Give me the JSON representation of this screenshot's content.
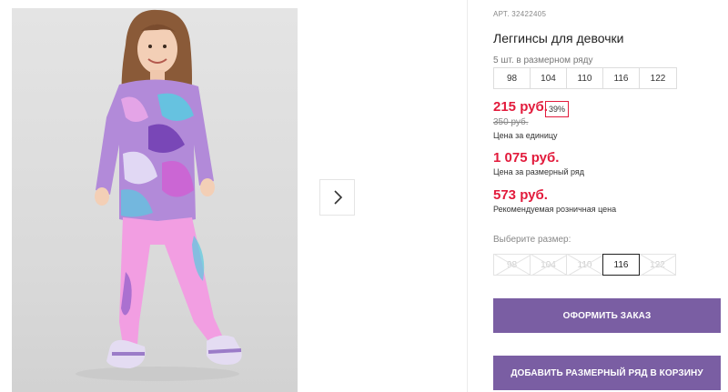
{
  "product": {
    "article": "АРТ. 32422405",
    "title": "Леггинсы для девочки",
    "size_row_caption": "5 шт. в размерном ряду",
    "size_row": [
      "98",
      "104",
      "110",
      "116",
      "122"
    ]
  },
  "pricing": {
    "unit_price": "215 руб.",
    "discount": "39%",
    "old_price": "350 руб.",
    "unit_caption": "Цена за единицу",
    "row_price": "1 075 руб.",
    "row_caption": "Цена за размерный ряд",
    "retail_price": "573 руб.",
    "retail_caption": "Рекомендуемая розничная цена",
    "accent_color": "#e21b3c"
  },
  "size_select": {
    "label": "Выберите размер:",
    "options": [
      {
        "label": "98",
        "available": false
      },
      {
        "label": "104",
        "available": false
      },
      {
        "label": "110",
        "available": false
      },
      {
        "label": "116",
        "available": true,
        "selected": true
      },
      {
        "label": "122",
        "available": false
      }
    ]
  },
  "actions": {
    "order_label": "ОФОРМИТЬ ЗАКАЗ",
    "add_row_label": "ДОБАВИТЬ РАЗМЕРНЫЙ РЯД В КОРЗИНУ",
    "button_color": "#7a5ea3"
  },
  "gallery": {
    "next_icon": "chevron-right-icon"
  }
}
